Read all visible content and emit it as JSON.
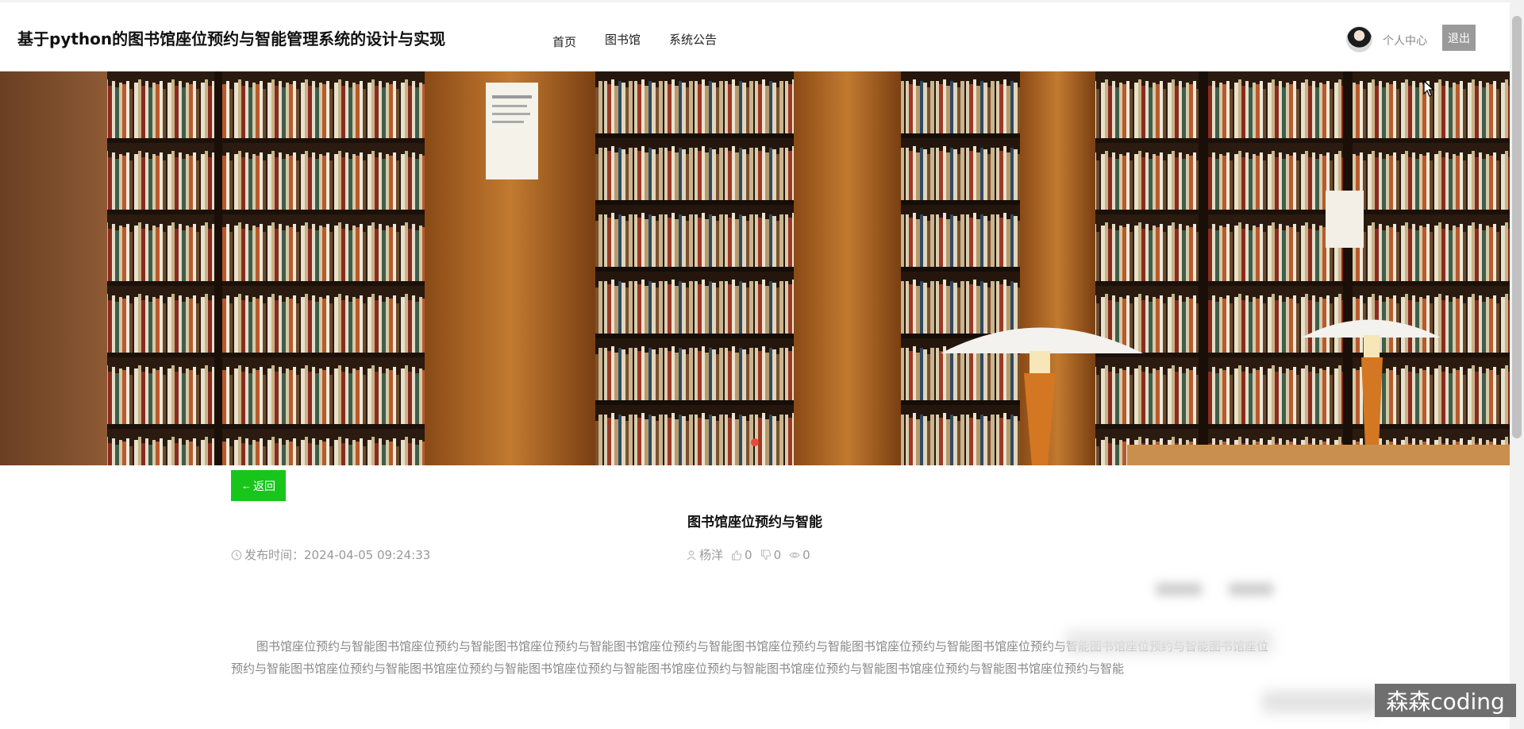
{
  "header": {
    "site_title": "基于python的图书馆座位预约与智能管理系统的设计与实现",
    "nav": [
      {
        "label": "首页"
      },
      {
        "label": "图书馆"
      },
      {
        "label": "系统公告"
      }
    ],
    "user_center_label": "个人中心",
    "logout_label": "退出"
  },
  "banner": {
    "image": "library-bookshelves-with-lamps",
    "colors": {
      "wood": "#b0661f",
      "shelf": "#2a1a0f",
      "lamp": "#f4f2ee"
    }
  },
  "article": {
    "back_label": "返回",
    "title": "图书馆座位预约与智能",
    "publish_label": "发布时间：",
    "publish_time": "2024-04-05 09:24:33",
    "author": "杨洋",
    "likes": "0",
    "dislikes": "0",
    "views": "0",
    "body": "图书馆座位预约与智能图书馆座位预约与智能图书馆座位预约与智能图书馆座位预约与智能图书馆座位预约与智能图书馆座位预约与智能图书馆座位预约与智能图书馆座位预约与智能图书馆座位预约与智能图书馆座位预约与智能图书馆座位预约与智能图书馆座位预约与智能图书馆座位预约与智能图书馆座位预约与智能图书馆座位预约与智能图书馆座位预约与智能"
  },
  "watermark": "森森coding",
  "colors": {
    "accent_green": "#18c51b",
    "logout_gray": "#9a9a9a",
    "carousel_dot": "#e64a3b"
  }
}
